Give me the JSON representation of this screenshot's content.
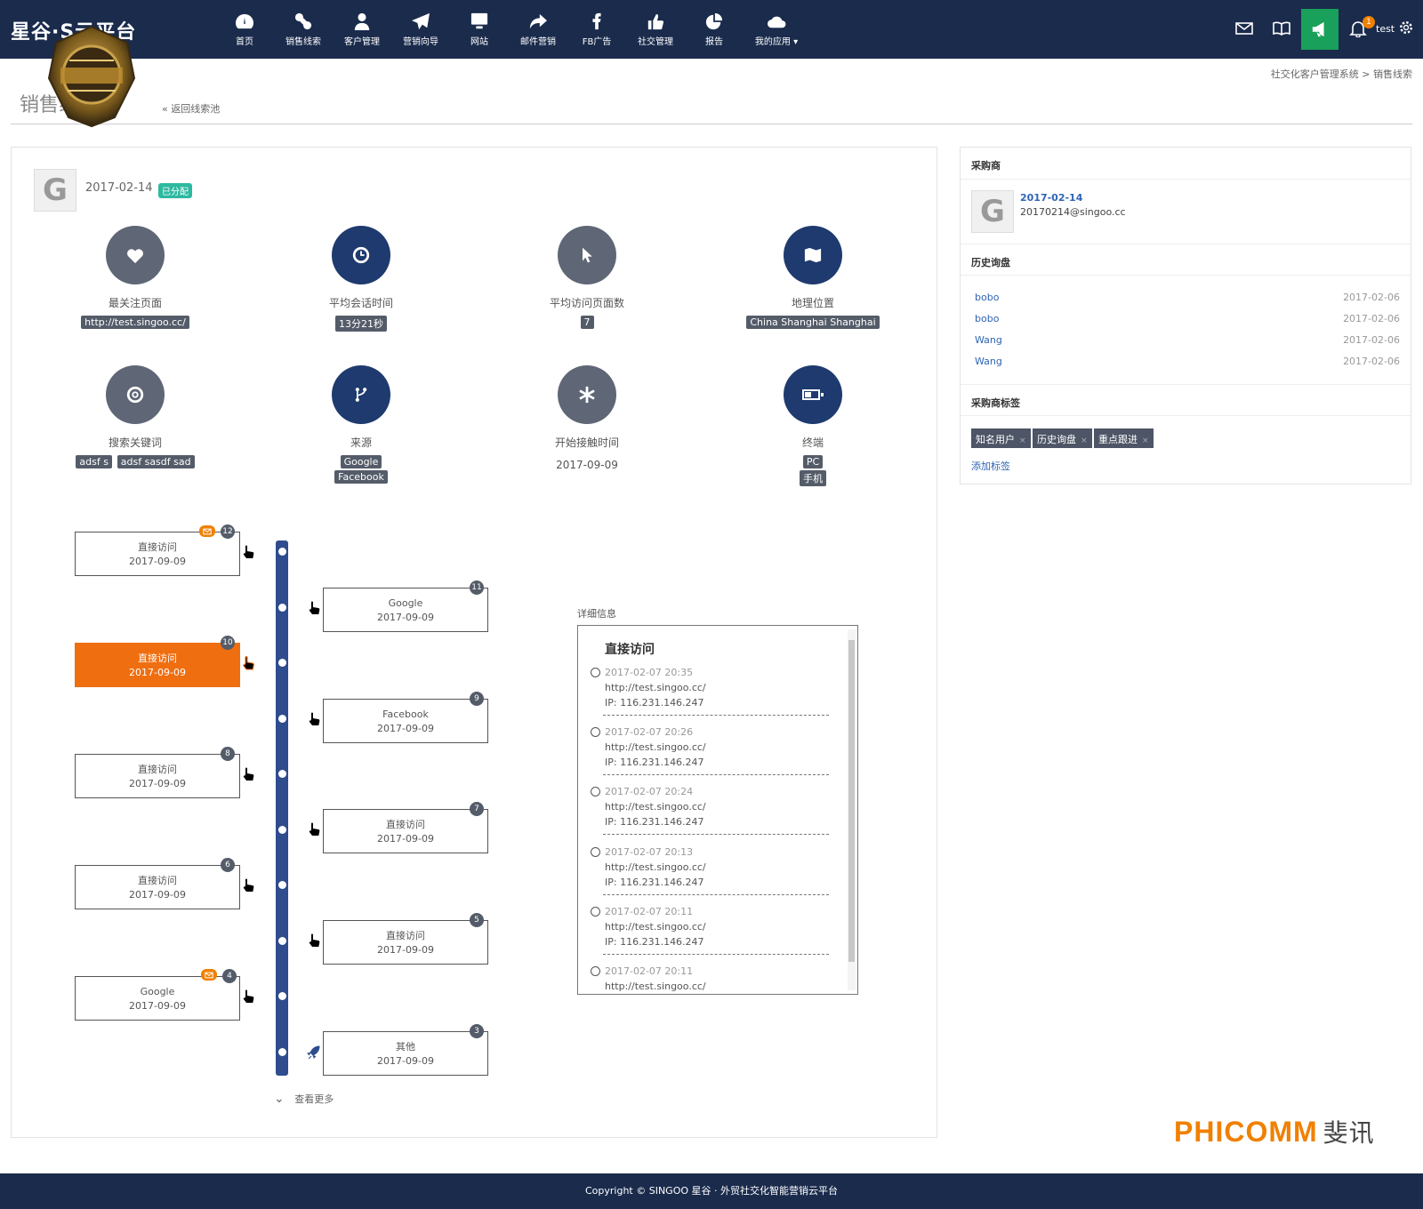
{
  "header": {
    "brand": "星谷·S云平台",
    "nav": [
      {
        "label": "首页",
        "icon": "dashboard-icon"
      },
      {
        "label": "销售线索",
        "icon": "link-icon"
      },
      {
        "label": "客户管理",
        "icon": "user-icon"
      },
      {
        "label": "营销向导",
        "icon": "paper-plane-icon"
      },
      {
        "label": "网站",
        "icon": "monitor-icon"
      },
      {
        "label": "邮件营销",
        "icon": "share-icon"
      },
      {
        "label": "FB广告",
        "icon": "facebook-icon"
      },
      {
        "label": "社交管理",
        "icon": "thumbs-up-icon"
      },
      {
        "label": "报告",
        "icon": "pie-chart-icon"
      },
      {
        "label": "我的应用",
        "icon": "cloud-icon"
      }
    ],
    "notification_count": "1",
    "username": "test"
  },
  "page": {
    "title": "销售线",
    "back_link": "返回线索池",
    "breadcrumb": "社交化客户管理系统 > 销售线索"
  },
  "lead": {
    "date": "2017-02-14",
    "status": "已分配",
    "stats": [
      {
        "label": "最关注页面",
        "icon": "heart-icon",
        "tags": [
          "http://test.singoo.cc/"
        ]
      },
      {
        "label": "平均会话时间",
        "icon": "clock-icon",
        "tags": [
          "13分21秒"
        ]
      },
      {
        "label": "平均访问页面数",
        "icon": "cursor-icon",
        "tags": [
          "7"
        ]
      },
      {
        "label": "地理位置",
        "icon": "map-icon",
        "tags": [
          "China Shanghai Shanghai"
        ]
      },
      {
        "label": "搜索关键词",
        "icon": "target-icon",
        "tags": [
          "adsf s",
          "adsf sasdf sad"
        ]
      },
      {
        "label": "来源",
        "icon": "branch-icon",
        "tags": [
          "Google",
          "Facebook"
        ]
      },
      {
        "label": "开始接触时间",
        "icon": "asterisk-icon",
        "value": "2017-09-09"
      },
      {
        "label": "终端",
        "icon": "battery-icon",
        "tags": [
          "PC",
          "手机"
        ]
      }
    ]
  },
  "timeline": {
    "left": [
      {
        "title": "直接访问",
        "date": "2017-09-09",
        "count": "12",
        "mail": true
      },
      {
        "title": "直接访问",
        "date": "2017-09-09",
        "count": "10",
        "active": true
      },
      {
        "title": "直接访问",
        "date": "2017-09-09",
        "count": "8"
      },
      {
        "title": "直接访问",
        "date": "2017-09-09",
        "count": "6"
      },
      {
        "title": "Google",
        "date": "2017-09-09",
        "count": "4",
        "mail": true
      }
    ],
    "right": [
      {
        "title": "Google",
        "date": "2017-09-09",
        "count": "11"
      },
      {
        "title": "Facebook",
        "date": "2017-09-09",
        "count": "9"
      },
      {
        "title": "直接访问",
        "date": "2017-09-09",
        "count": "7"
      },
      {
        "title": "直接访问",
        "date": "2017-09-09",
        "count": "5"
      },
      {
        "title": "其他",
        "date": "2017-09-09",
        "count": "3",
        "rocket": true
      }
    ],
    "more": "查看更多"
  },
  "details": {
    "title": "详细信息",
    "heading": "直接访问",
    "entries": [
      {
        "time": "2017-02-07 20:35",
        "url": "http://test.singoo.cc/",
        "ip": "IP: 116.231.146.247"
      },
      {
        "time": "2017-02-07 20:26",
        "url": "http://test.singoo.cc/",
        "ip": "IP: 116.231.146.247"
      },
      {
        "time": "2017-02-07 20:24",
        "url": "http://test.singoo.cc/",
        "ip": "IP: 116.231.146.247"
      },
      {
        "time": "2017-02-07 20:13",
        "url": "http://test.singoo.cc/",
        "ip": "IP: 116.231.146.247"
      },
      {
        "time": "2017-02-07 20:11",
        "url": "http://test.singoo.cc/",
        "ip": "IP: 116.231.146.247"
      },
      {
        "time": "2017-02-07 20:11",
        "url": "http://test.singoo.cc/",
        "ip": ""
      }
    ]
  },
  "sidebar": {
    "buyer_title": "采购商",
    "buyer_date": "2017-02-14",
    "buyer_email": "20170214@singoo.cc",
    "history_title": "历史询盘",
    "history": [
      {
        "name": "bobo",
        "date": "2017-02-06"
      },
      {
        "name": "bobo",
        "date": "2017-02-06"
      },
      {
        "name": "Wang",
        "date": "2017-02-06"
      },
      {
        "name": "Wang",
        "date": "2017-02-06"
      }
    ],
    "tags_title": "采购商标签",
    "tags": [
      "知名用户",
      "历史询盘",
      "重点跟进"
    ],
    "add_tag": "添加标签"
  },
  "watermark": {
    "brand": "PHICOMM",
    "cn": "斐讯"
  },
  "footer": "Copyright © SINGOO 星谷 · 外贸社交化智能营销云平台",
  "colors": {
    "nav": "#1a2b4c",
    "accent": "#ef6e10",
    "green": "#19a05a",
    "timeline": "#2f4c8e"
  }
}
